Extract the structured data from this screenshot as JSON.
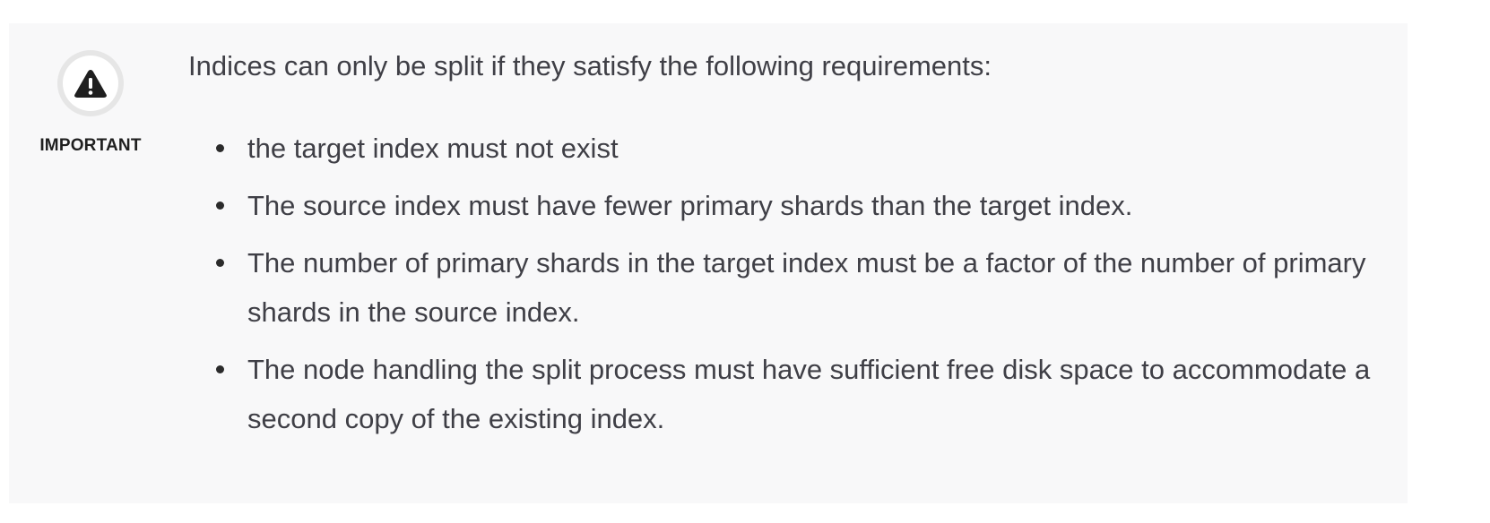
{
  "callout": {
    "label": "IMPORTANT",
    "icon": "warning-triangle-icon",
    "intro": "Indices can only be split if they satisfy the following requirements:",
    "requirements": [
      "the target index must not exist",
      "The source index must have fewer primary shards than the target index.",
      "The number of primary shards in the target index must be a factor of the number of primary shards in the source index.",
      "The node handling the split process must have sufficient free disk space to accommodate a second copy of the existing index."
    ]
  },
  "colors": {
    "background": "#f8f8f9",
    "text": "#3f3f46",
    "icon": "#1f1f1f"
  }
}
